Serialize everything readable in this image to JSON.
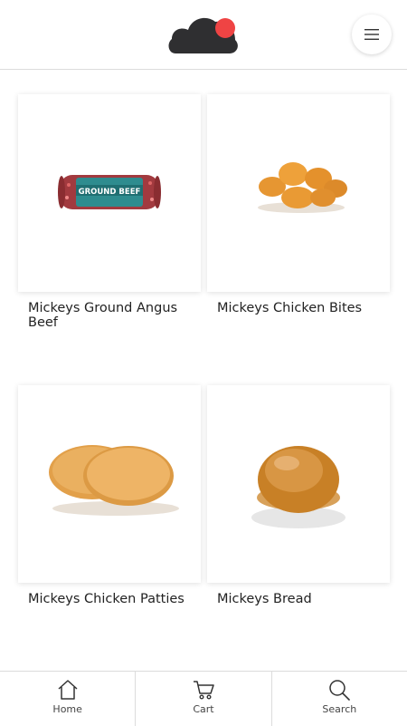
{
  "header": {
    "logo_icon": "cloud-logo-icon",
    "menu_icon": "hamburger-menu-icon",
    "logo_color": "#2f2f31",
    "logo_dot_color": "#ef4444"
  },
  "products": [
    {
      "name": "Mickeys Ground Angus Beef",
      "image": "ground-beef-image"
    },
    {
      "name": "Mickeys Chicken Bites",
      "image": "chicken-bites-image"
    },
    {
      "name": "Mickeys Chicken Patties",
      "image": "chicken-patties-image"
    },
    {
      "name": "Mickeys Bread",
      "image": "bread-bun-image"
    }
  ],
  "nav": {
    "items": [
      {
        "label": "Home",
        "icon": "home-icon"
      },
      {
        "label": "Cart",
        "icon": "cart-icon"
      },
      {
        "label": "Search",
        "icon": "search-icon"
      }
    ]
  }
}
